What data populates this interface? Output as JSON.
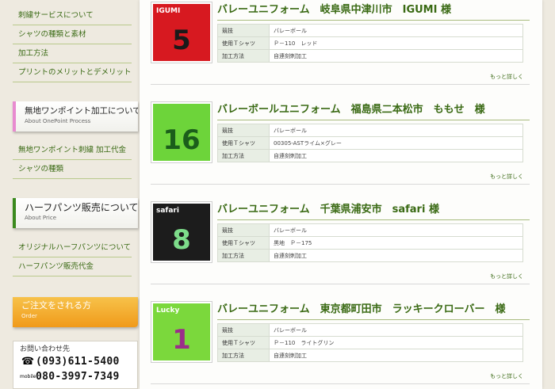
{
  "sidebar": {
    "nav_top": [
      {
        "label": "刺繍サービスについて"
      },
      {
        "label": "シャツの種類と素材"
      },
      {
        "label": "加工方法"
      },
      {
        "label": "プリントのメリットとデメリット"
      }
    ],
    "onepoint": {
      "title": "無地ワンポイント加工について",
      "subtitle": "About OnePoint Process",
      "items": [
        {
          "label": "無地ワンポイント刺繍 加工代金"
        },
        {
          "label": "シャツの種類"
        }
      ]
    },
    "halfpants": {
      "title": "ハーフパンツ販売について",
      "subtitle": "About Price",
      "items": [
        {
          "label": "オリジナルハーフパンツについて"
        },
        {
          "label": "ハーフパンツ販売代金"
        }
      ]
    },
    "order": {
      "title": "ご注文をされる方",
      "subtitle": "Order"
    },
    "contact": {
      "label": "お問い合わせ先",
      "phone_icon": "☎",
      "phone": "(093)611-5400",
      "mobile_icon": "mobile",
      "mobile": "080-3997-7349"
    }
  },
  "entries": [
    {
      "title": "バレーユニフォーム　岐阜県中津川市　IGUMI 様",
      "jersey": {
        "color": "#d71920",
        "num_color": "#1a1a1a",
        "top_text": "IGUMI",
        "number": "5"
      },
      "rows": [
        {
          "k": "競技",
          "v": "バレーボール"
        },
        {
          "k": "使用Ｔシャツ",
          "v": "Ｐ－110　レッド"
        },
        {
          "k": "加工方法",
          "v": "自連刻刺加工"
        }
      ],
      "more": "もっと詳しく"
    },
    {
      "title": "バレーボールユニフォーム　福島県二本松市　ももせ　様",
      "jersey": {
        "color": "#6dd43a",
        "num_color": "#1b5e1b",
        "top_text": "",
        "number": "16"
      },
      "rows": [
        {
          "k": "競技",
          "v": "バレーボール"
        },
        {
          "k": "使用Ｔシャツ",
          "v": "00305-ASTライム×グレー"
        },
        {
          "k": "加工方法",
          "v": "自連刻刺加工"
        }
      ],
      "more": "もっと詳しく"
    },
    {
      "title": "バレーユニフォーム　千葉県浦安市　safari 様",
      "jersey": {
        "color": "#1c1c1c",
        "num_color": "#7ddc8a",
        "top_text": "safari",
        "number": "8"
      },
      "rows": [
        {
          "k": "競技",
          "v": "バレーボール"
        },
        {
          "k": "使用Ｔシャツ",
          "v": "黒地　Ｐ－175"
        },
        {
          "k": "加工方法",
          "v": "自連刻刺加工"
        }
      ],
      "more": "もっと詳しく"
    },
    {
      "title": "バレーユニフォーム　東京都町田市　ラッキークローバー　様",
      "jersey": {
        "color": "#7bd83c",
        "num_color": "#9b2d8a",
        "top_text": "Lucky",
        "number": "1"
      },
      "rows": [
        {
          "k": "競技",
          "v": "バレーボール"
        },
        {
          "k": "使用Ｔシャツ",
          "v": "Ｐ－110　ライトグリン"
        },
        {
          "k": "加工方法",
          "v": "自連刻刺加工"
        }
      ],
      "more": "もっと詳しく"
    }
  ]
}
